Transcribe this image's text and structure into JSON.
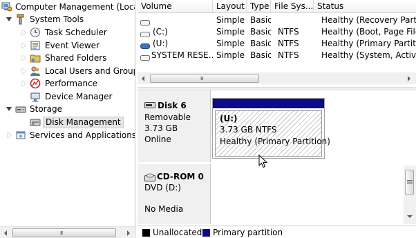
{
  "tree": {
    "items": [
      {
        "label": "Computer Management (Local",
        "icon": "computer-management-icon"
      },
      {
        "label": "System Tools",
        "icon": "system-tools-icon"
      },
      {
        "label": "Task Scheduler",
        "icon": "clock-icon"
      },
      {
        "label": "Event Viewer",
        "icon": "event-viewer-icon"
      },
      {
        "label": "Shared Folders",
        "icon": "shared-folders-icon"
      },
      {
        "label": "Local Users and Groups",
        "icon": "users-icon"
      },
      {
        "label": "Performance",
        "icon": "performance-icon"
      },
      {
        "label": "Device Manager",
        "icon": "device-manager-icon"
      },
      {
        "label": "Storage",
        "icon": "storage-icon"
      },
      {
        "label": "Disk Management",
        "icon": "disk-management-icon"
      },
      {
        "label": "Services and Applications",
        "icon": "services-icon"
      }
    ],
    "selected": "Disk Management"
  },
  "volume_list": {
    "columns": [
      "Volume",
      "Layout",
      "Type",
      "File Sys...",
      "Status"
    ],
    "rows": [
      {
        "volume": "",
        "layout": "Simple",
        "type": "Basic",
        "fs": "",
        "status": "Healthy (Recovery Partitio"
      },
      {
        "volume": "(C:)",
        "layout": "Simple",
        "type": "Basic",
        "fs": "NTFS",
        "status": "Healthy (Boot, Page File, C"
      },
      {
        "volume": "(U:)",
        "layout": "Simple",
        "type": "Basic",
        "fs": "NTFS",
        "status": "Healthy (Primary Partition"
      },
      {
        "volume": "SYSTEM RESE...",
        "layout": "Simple",
        "type": "Basic",
        "fs": "NTFS",
        "status": "Healthy (System, Active, P"
      }
    ],
    "scroll_grip": "III"
  },
  "disks": [
    {
      "name": "Disk 6",
      "kind": "Removable",
      "size": "3.73 GB",
      "state": "Online",
      "partition": {
        "name": "(U:)",
        "size_fs": "3.73 GB NTFS",
        "status": "Healthy (Primary Partition)"
      }
    },
    {
      "name": "CD-ROM 0",
      "kind": "DVD (D:)",
      "media": "No Media"
    }
  ],
  "tree_scroll_grip": "III",
  "legend": [
    {
      "label": "Unallocated",
      "color": "#000000"
    },
    {
      "label": "Primary partition",
      "color": "#0c0c8a"
    }
  ]
}
